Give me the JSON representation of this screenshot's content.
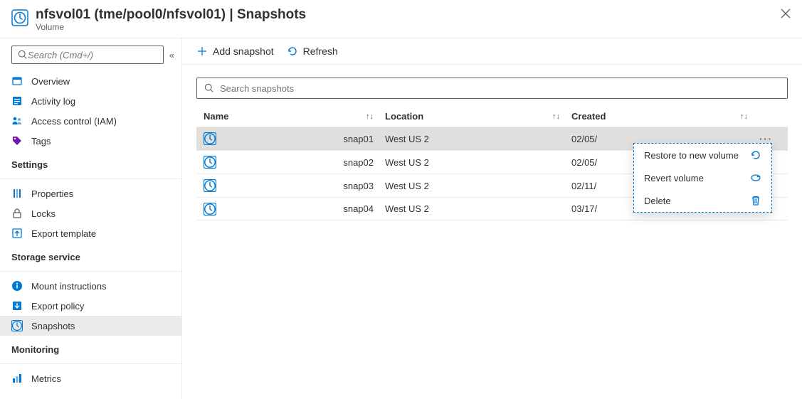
{
  "header": {
    "title": "nfsvol01 (tme/pool0/nfsvol01) | Snapshots",
    "subtitle": "Volume"
  },
  "sidebar": {
    "search_placeholder": "Search (Cmd+/)",
    "items": {
      "overview": "Overview",
      "activity_log": "Activity log",
      "access_control": "Access control (IAM)",
      "tags": "Tags"
    },
    "settings_header": "Settings",
    "settings": {
      "properties": "Properties",
      "locks": "Locks",
      "export_template": "Export template"
    },
    "storage_header": "Storage service",
    "storage": {
      "mount": "Mount instructions",
      "export_policy": "Export policy",
      "snapshots": "Snapshots"
    },
    "monitoring_header": "Monitoring",
    "monitoring": {
      "metrics": "Metrics"
    }
  },
  "toolbar": {
    "add_snapshot": "Add snapshot",
    "refresh": "Refresh"
  },
  "main": {
    "search_placeholder": "Search snapshots",
    "columns": {
      "name": "Name",
      "location": "Location",
      "created": "Created"
    },
    "rows": [
      {
        "name": "snap01",
        "location": "West US 2",
        "created": "02/05/"
      },
      {
        "name": "snap02",
        "location": "West US 2",
        "created": "02/05/"
      },
      {
        "name": "snap03",
        "location": "West US 2",
        "created": "02/11/"
      },
      {
        "name": "snap04",
        "location": "West US 2",
        "created": "03/17/"
      }
    ]
  },
  "context_menu": {
    "restore": "Restore to new volume",
    "revert": "Revert volume",
    "delete": "Delete"
  }
}
